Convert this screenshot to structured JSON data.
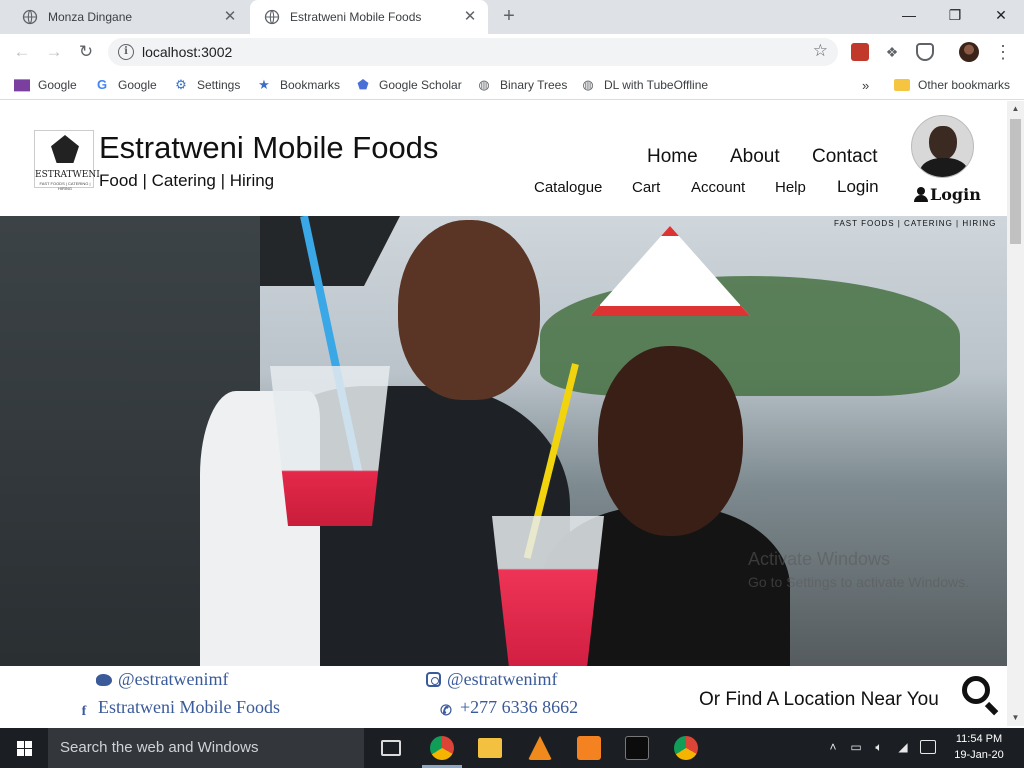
{
  "browser": {
    "tabs": [
      {
        "title": "Monza Dingane",
        "active": false
      },
      {
        "title": "Estratweni Mobile Foods",
        "active": true
      }
    ],
    "url": "localhost:3002",
    "bookmarks": [
      {
        "label": "Google",
        "icon": "gmail-icon"
      },
      {
        "label": "Google",
        "icon": "google-icon"
      },
      {
        "label": "Settings",
        "icon": "gear-icon"
      },
      {
        "label": "Bookmarks",
        "icon": "star-icon"
      },
      {
        "label": "Google Scholar",
        "icon": "scholar-icon"
      },
      {
        "label": "Binary Trees",
        "icon": "globe-icon"
      },
      {
        "label": "DL with TubeOffline",
        "icon": "globe-icon"
      }
    ],
    "more_bookmarks": "»",
    "other_bookmarks": "Other bookmarks"
  },
  "site": {
    "brand": "Estratweni Mobile Foods",
    "tagline": "Food | Catering | Hiring",
    "logo_text": "ESTRATWENI",
    "logo_subtext": "FAST FOODS | CATERING | HIRING",
    "nav_primary": [
      "Home",
      "About",
      "Contact"
    ],
    "nav_secondary": [
      "Catalogue",
      "Cart",
      "Account",
      "Help",
      "Login"
    ],
    "login_button": "Login",
    "hero_tagline": "FAST FOODS | CATERING | HIRING"
  },
  "footer": {
    "twitter": "@estratwenimf",
    "facebook": "Estratweni Mobile Foods",
    "instagram": "@estratwenimf",
    "whatsapp": "+277 6336 8662",
    "locator": "Or Find A Location Near You"
  },
  "watermark": {
    "line1": "Activate Windows",
    "line2": "Go to Settings to activate Windows."
  },
  "taskbar": {
    "search_placeholder": "Search the web and Windows",
    "time": "11:54 PM",
    "date": "19-Jan-20"
  },
  "colors": {
    "social_blue": "#3a5a9a",
    "taskbar_bg": "#1b1f24",
    "tabstrip_bg": "#dee1e6"
  }
}
